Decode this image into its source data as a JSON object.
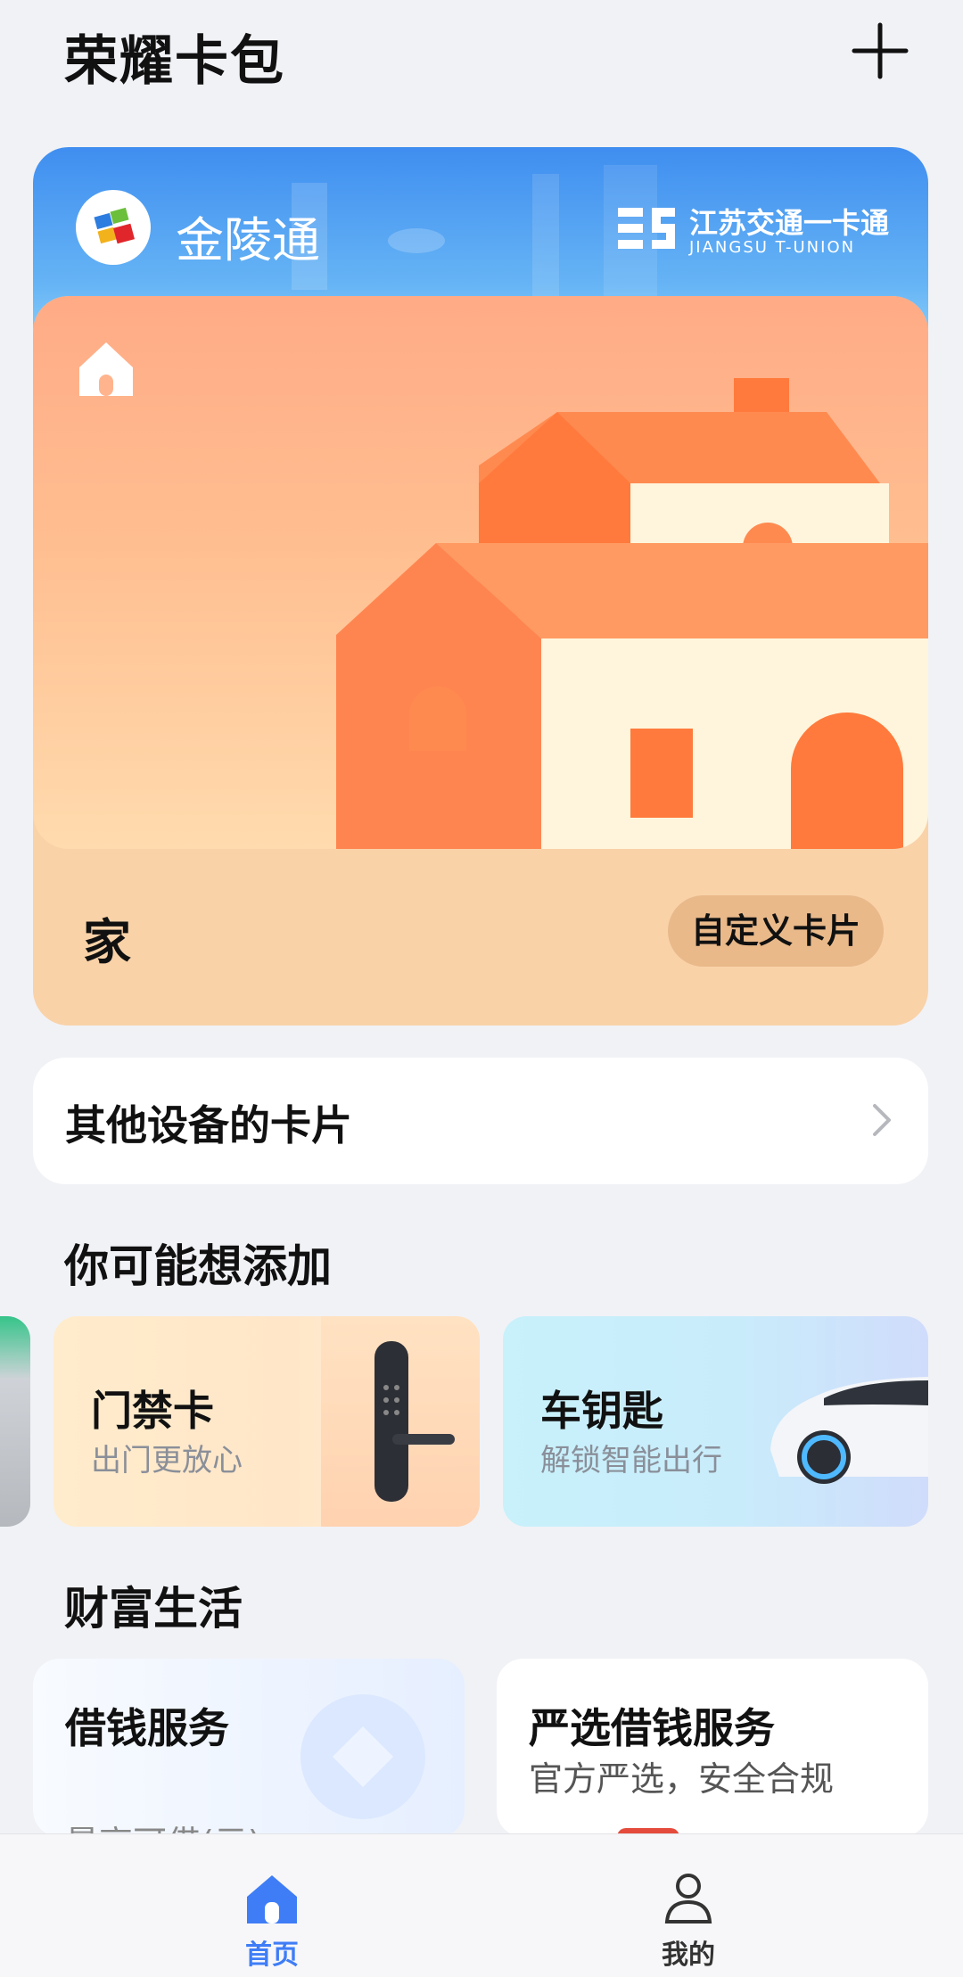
{
  "header": {
    "title": "荣耀卡包"
  },
  "transit_card": {
    "name": "金陵通",
    "issuer_name": "江苏交通一卡通",
    "issuer_name_en": "JIANGSU T-UNION"
  },
  "home_card": {
    "label": "家",
    "customize_label": "自定义卡片"
  },
  "other_devices": {
    "label": "其他设备的卡片"
  },
  "suggestions": {
    "title": "你可能想添加",
    "items": [
      {
        "title": "门禁卡",
        "subtitle": "出门更放心"
      },
      {
        "title": "车钥匙",
        "subtitle": "解锁智能出行"
      }
    ]
  },
  "wealth": {
    "title": "财富生活",
    "items": [
      {
        "title": "借钱服务",
        "subtitle": "最高可借(元)"
      },
      {
        "title": "严选借钱服务",
        "subtitle": "官方严选，安全合规"
      }
    ]
  },
  "nav": {
    "items": [
      {
        "label": "首页",
        "active": true
      },
      {
        "label": "我的",
        "active": false
      }
    ]
  },
  "colors": {
    "accent": "#3f7df6",
    "background": "#f1f2f6",
    "transit_blue": "#3f8ef0",
    "home_peach": "#f9d2a8"
  }
}
